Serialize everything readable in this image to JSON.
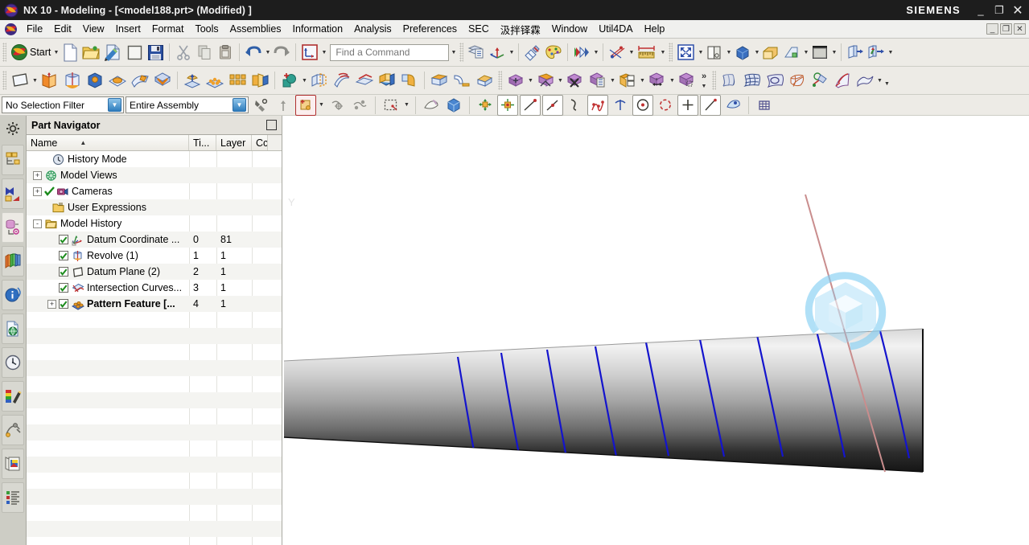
{
  "titlebar": {
    "app_title": "NX 10 - Modeling - [<model188.prt> (Modified) ]",
    "brand": "SIEMENS",
    "minimize": "_",
    "maximize": "❐",
    "close": "✕"
  },
  "menubar": {
    "items": [
      {
        "label": "File"
      },
      {
        "label": "Edit"
      },
      {
        "label": "View"
      },
      {
        "label": "Insert"
      },
      {
        "label": "Format"
      },
      {
        "label": "Tools"
      },
      {
        "label": "Assemblies"
      },
      {
        "label": "Information"
      },
      {
        "label": "Analysis"
      },
      {
        "label": "Preferences"
      },
      {
        "label": "SEC"
      },
      {
        "label": "汲拌铎霖"
      },
      {
        "label": "Window"
      },
      {
        "label": "Util4DA"
      },
      {
        "label": "Help"
      }
    ],
    "minimize": "_",
    "restore": "❐",
    "close": "✕"
  },
  "toolbar_standard": {
    "start_label": "Start",
    "dropdown_glyph": "▼",
    "buttons": [
      {
        "name": "start-menu",
        "label": "Start"
      },
      {
        "name": "new-file",
        "label": "New"
      },
      {
        "name": "open-file",
        "label": "Open"
      },
      {
        "name": "edit-sketch",
        "label": "Sketch"
      },
      {
        "name": "blank-doc",
        "label": "Blank"
      },
      {
        "name": "save",
        "label": "Save"
      },
      {
        "name": "cut",
        "label": "Cut"
      },
      {
        "name": "copy",
        "label": "Copy"
      },
      {
        "name": "paste",
        "label": "Paste"
      },
      {
        "name": "undo",
        "label": "Undo"
      },
      {
        "name": "redo",
        "label": "Redo"
      },
      {
        "name": "wcs-display",
        "label": "WCS"
      },
      {
        "name": "assembly-navigator",
        "label": "Assemblies"
      },
      {
        "name": "wcs-dynamics",
        "label": "WCS Dynamics"
      },
      {
        "name": "render-style",
        "label": "Render Style"
      },
      {
        "name": "palette",
        "label": "Palette"
      },
      {
        "name": "true-shading",
        "label": "True Shading"
      },
      {
        "name": "sketch-constraints",
        "label": "Constraints"
      },
      {
        "name": "measure",
        "label": "Measure"
      },
      {
        "name": "fit-view",
        "label": "Fit"
      },
      {
        "name": "section-view",
        "label": "Section"
      },
      {
        "name": "shaded-view",
        "label": "Shaded"
      },
      {
        "name": "layer-settings",
        "label": "Layers"
      },
      {
        "name": "view-plane",
        "label": "View Plane"
      },
      {
        "name": "background-color",
        "label": "Background"
      },
      {
        "name": "move-object",
        "label": "Move Object"
      },
      {
        "name": "wcs-origin",
        "label": "WCS Origin"
      }
    ],
    "find_command": {
      "value": "",
      "placeholder": "Find a Command"
    }
  },
  "toolbar_feature": {
    "overflow_glyph": "»",
    "buttons": [
      {
        "name": "datum-plane",
        "label": "Datum Plane"
      },
      {
        "name": "sketch",
        "label": "Sketch"
      },
      {
        "name": "revolve",
        "label": "Revolve"
      },
      {
        "name": "extrude",
        "label": "Extrude"
      },
      {
        "name": "hole",
        "label": "Hole"
      },
      {
        "name": "shell",
        "label": "Shell"
      },
      {
        "name": "unite",
        "label": "Unite"
      },
      {
        "name": "draft",
        "label": "Draft"
      },
      {
        "name": "pattern-feature",
        "label": "Pattern Feature"
      },
      {
        "name": "mirror-feature",
        "label": "Mirror Feature"
      },
      {
        "name": "pattern-geometry",
        "label": "Pattern Geometry"
      },
      {
        "name": "sketch-curve",
        "label": "Sketch Curve"
      },
      {
        "name": "trim-body",
        "label": "Trim Body"
      },
      {
        "name": "offset-surface",
        "label": "Offset Surface"
      },
      {
        "name": "thicken",
        "label": "Thicken"
      },
      {
        "name": "sew",
        "label": "Sew"
      },
      {
        "name": "edge-blend",
        "label": "Edge Blend"
      },
      {
        "name": "chamfer",
        "label": "Chamfer"
      },
      {
        "name": "face-blend",
        "label": "Face Blend"
      },
      {
        "name": "move-face",
        "label": "Move Face"
      },
      {
        "name": "replace-face",
        "label": "Replace Face"
      },
      {
        "name": "delete-face",
        "label": "Delete Face"
      },
      {
        "name": "copy-face",
        "label": "Copy Face"
      },
      {
        "name": "split-face",
        "label": "Split Face"
      },
      {
        "name": "resize-face",
        "label": "Resize Face"
      },
      {
        "name": "offset-region",
        "label": "Offset Region"
      },
      {
        "name": "through-curves",
        "label": "Through Curves"
      },
      {
        "name": "through-curve-mesh",
        "label": "Through Curve Mesh"
      },
      {
        "name": "studio-surface",
        "label": "Studio Surface"
      },
      {
        "name": "n-sided-surface",
        "label": "N-sided Surface"
      },
      {
        "name": "law-extension",
        "label": "Law Extension"
      },
      {
        "name": "trim-sheet",
        "label": "Trim Sheet"
      },
      {
        "name": "enlarge",
        "label": "Enlarge"
      }
    ]
  },
  "selection_bar": {
    "filter": {
      "value": "No Selection Filter",
      "arrow": "▼"
    },
    "scope": {
      "value": "Entire Assembly",
      "arrow": "▼"
    },
    "buttons": [
      {
        "name": "find-object",
        "label": "Find Object"
      },
      {
        "name": "up-one-level",
        "label": "Up One Level"
      },
      {
        "name": "snap-point-toggle",
        "label": "Snap Point"
      },
      {
        "name": "select-vertex",
        "label": "Select Vertex"
      },
      {
        "name": "select-feature",
        "label": "Select Feature"
      },
      {
        "name": "rectangle-select",
        "label": "Rectangle Select"
      },
      {
        "name": "erase-highlight",
        "label": "Erase Highlight"
      },
      {
        "name": "display-solid",
        "label": "Display Solid"
      },
      {
        "name": "snap-end-point",
        "label": "End Point"
      },
      {
        "name": "snap-midpoint",
        "label": "Midpoint"
      },
      {
        "name": "snap-control-point",
        "label": "Control Point"
      },
      {
        "name": "snap-intersection",
        "label": "Intersection Point"
      },
      {
        "name": "snap-arc-center",
        "label": "Arc Center"
      },
      {
        "name": "snap-quadrant",
        "label": "Quadrant Point"
      },
      {
        "name": "snap-existing-point",
        "label": "Existing Point"
      },
      {
        "name": "snap-point-on-curve",
        "label": "Point on Curve"
      },
      {
        "name": "snap-point-on-face",
        "label": "Point on Face"
      },
      {
        "name": "snap-grid",
        "label": "Grid Point"
      }
    ]
  },
  "resource_bar": {
    "gear": {
      "name": "resource-bar-options"
    },
    "items": [
      {
        "name": "assembly-navigator",
        "label": "Assembly Navigator"
      },
      {
        "name": "constraint-navigator",
        "label": "Constraint Navigator"
      },
      {
        "name": "part-navigator",
        "label": "Part Navigator",
        "selected": true
      },
      {
        "name": "reuse-library",
        "label": "Reuse Library"
      },
      {
        "name": "hd3d-tools",
        "label": "HD3D Tools"
      },
      {
        "name": "web-browser",
        "label": "Web Browser"
      },
      {
        "name": "history",
        "label": "History"
      },
      {
        "name": "system-materials",
        "label": "System Materials"
      },
      {
        "name": "process-studio",
        "label": "Process Studio"
      },
      {
        "name": "roles",
        "label": "Roles"
      },
      {
        "name": "system-scene",
        "label": "System Scene"
      }
    ]
  },
  "part_navigator": {
    "title": "Part Navigator",
    "maximize_glyph": "",
    "columns": [
      {
        "label": "Name",
        "sort": "▲"
      },
      {
        "label": "Ti..."
      },
      {
        "label": "Layer"
      },
      {
        "label": "Cc"
      }
    ],
    "rows": [
      {
        "label": "History Mode",
        "indent": 1,
        "expander": "",
        "check": false,
        "icon": "clock-icon",
        "timestamp": "",
        "layer": "",
        "bold": false
      },
      {
        "label": "Model Views",
        "indent": 0,
        "expander": "+",
        "check": false,
        "icon": "model-views-icon",
        "timestamp": "",
        "layer": "",
        "bold": false
      },
      {
        "label": "Cameras",
        "indent": 0,
        "expander": "+",
        "check": true,
        "icon": "camera-icon",
        "timestamp": "",
        "layer": "",
        "bold": false,
        "greencheck_only": true
      },
      {
        "label": "User Expressions",
        "indent": 1,
        "expander": "",
        "check": false,
        "icon": "folder-expr-icon",
        "timestamp": "",
        "layer": "",
        "bold": false
      },
      {
        "label": "Model History",
        "indent": 0,
        "expander": "-",
        "check": false,
        "icon": "folder-icon",
        "timestamp": "",
        "layer": "",
        "bold": false
      },
      {
        "label": "Datum Coordinate ...",
        "indent": 2,
        "expander": "",
        "check": true,
        "icon": "datum-csys-icon",
        "timestamp": "0",
        "layer": "81",
        "bold": false
      },
      {
        "label": "Revolve (1)",
        "indent": 2,
        "expander": "",
        "check": true,
        "icon": "revolve-icon",
        "timestamp": "1",
        "layer": "1",
        "bold": false
      },
      {
        "label": "Datum Plane (2)",
        "indent": 2,
        "expander": "",
        "check": true,
        "icon": "datum-plane-icon",
        "timestamp": "2",
        "layer": "1",
        "bold": false
      },
      {
        "label": "Intersection Curves...",
        "indent": 2,
        "expander": "",
        "check": true,
        "icon": "intersection-curves-icon",
        "timestamp": "3",
        "layer": "1",
        "bold": false
      },
      {
        "label": "Pattern Feature [...",
        "indent": 2,
        "expander": "+",
        "check": true,
        "icon": "pattern-feature-icon",
        "timestamp": "4",
        "layer": "1",
        "bold": true
      }
    ]
  },
  "viewport": {
    "axis_label": "Y",
    "model": {
      "name": "tapered-cone-body",
      "description": "Shaded tapered conical body with blue helical intersection curves",
      "surface_gradient_top": "#f2f2f2",
      "surface_gradient_mid": "#b4b4b4",
      "surface_gradient_bottom": "#1c1c1c",
      "curve_color": "#1414cd",
      "axis_line_color": "#c98d8d",
      "curve_count": 8
    },
    "watermark": {
      "name": "cube-hexagon-watermark",
      "color": "#6fc4f0"
    }
  }
}
